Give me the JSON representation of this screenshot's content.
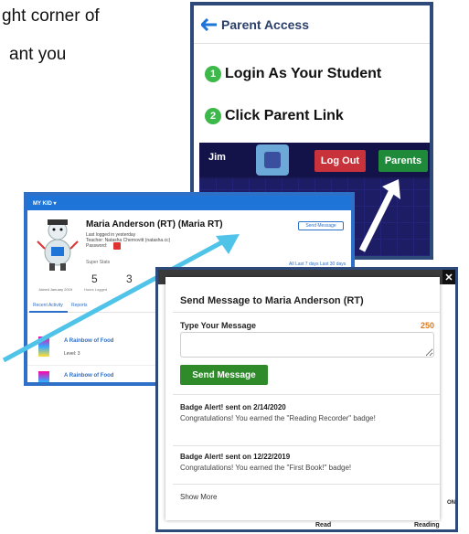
{
  "document": {
    "line_1": "ght corner of",
    "line_2": "ant you"
  },
  "parent_access": {
    "title": "Parent Access",
    "steps": [
      {
        "number": "1",
        "label": "Login As Your Student"
      },
      {
        "number": "2",
        "label": "Click Parent Link"
      }
    ],
    "game_bar": {
      "student": "Jim",
      "logout": "Log Out",
      "parents": "Parents"
    },
    "colors": {
      "step": "#3db84a",
      "logout": "#c8323a",
      "parents": "#1f8a3a"
    }
  },
  "kid_dashboard": {
    "menu": "MY KID ▾",
    "name": "Maria Anderson (RT) (Maria RT)",
    "last_logged": "Last logged in yesterday",
    "teacher": "Teacher:   Natasha Chernovitt (natasha.cc)",
    "password_label": "Password:",
    "send_message_button": "Send Message",
    "stats_label": "Super Stats",
    "stat_1": "5",
    "stat_1_label": "Hours Logged",
    "stat_2": "3",
    "filters": "All  Last 7 days  Last 30 days",
    "joined": "Joined January 2019",
    "tabs": [
      "Recent Activity",
      "Reports"
    ],
    "activity": [
      {
        "title": "A Rainbow of Food",
        "level": "Level: 3"
      },
      {
        "title": "A Rainbow of Food",
        "level": ""
      }
    ]
  },
  "message_modal": {
    "title": "Send Message to Maria Anderson (RT)",
    "type_label": "Type Your Message",
    "char_count": "250",
    "input_value": "",
    "send_label": "Send Message",
    "messages": [
      {
        "title": "Badge Alert! sent on 2/14/2020",
        "body": "Congratulations! You earned the \"Reading Recorder\" badge!"
      },
      {
        "title": "Badge Alert! sent on 12/22/2019",
        "body": "Congratulations! You earned the \"First Book!\" badge!"
      }
    ],
    "show_more": "Show More",
    "close_glyph": "✕",
    "footer_left": "Read",
    "footer_right": "Reading",
    "side_label": "ON",
    "colors": {
      "send": "#2f8a2a",
      "count": "#e07a18"
    }
  }
}
